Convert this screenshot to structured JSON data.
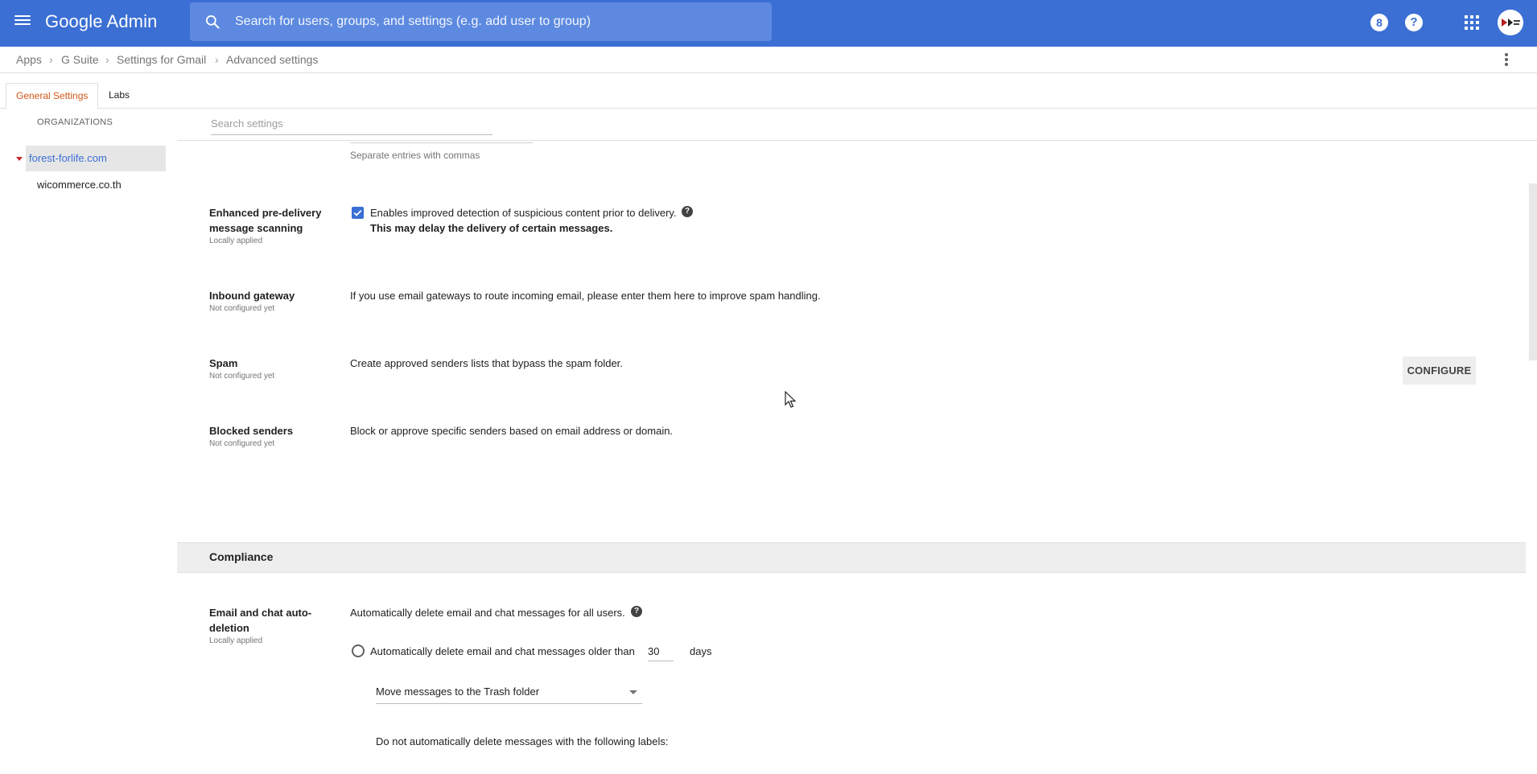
{
  "topbar": {
    "logo": "Google Admin",
    "search_placeholder": "Search for users, groups, and settings (e.g. add user to group)",
    "badge_icon": "8",
    "help_icon": "?",
    "accent": "#3b6fd4"
  },
  "breadcrumb": [
    "Apps",
    "G Suite",
    "Settings for Gmail",
    "Advanced settings"
  ],
  "tabs": [
    {
      "label": "General Settings",
      "active": true
    },
    {
      "label": "Labs",
      "active": false
    }
  ],
  "sidebar": {
    "heading": "ORGANIZATIONS",
    "orgs": [
      "forest-forlife.com",
      "wicommerce.co.th"
    ]
  },
  "settings_search": {
    "placeholder": "Search settings"
  },
  "prev_hint": "Separate entries with commas",
  "rows": [
    {
      "label": "Enhanced pre-delivery message scanning",
      "status": "Locally applied",
      "desc": "Enables improved detection of suspicious content prior to delivery.",
      "desc_bold": "This may delay the delivery of certain messages.",
      "checked": true
    },
    {
      "label": "Inbound gateway",
      "status": "Not configured yet",
      "desc": "If you use email gateways to route incoming email, please enter them here to improve spam handling."
    },
    {
      "label": "Spam",
      "status": "Not configured yet",
      "desc": "Create approved senders lists that bypass the spam folder.",
      "button": "CONFIGURE"
    },
    {
      "label": "Blocked senders",
      "status": "Not configured yet",
      "desc": "Block or approve specific senders based on email address or domain."
    }
  ],
  "compliance": {
    "section_title": "Compliance",
    "label": "Email and chat auto-deletion",
    "status": "Locally applied",
    "desc": "Automatically delete email and chat messages for all users.",
    "radio_label": "Automatically delete email and chat messages older than",
    "days_value": "30",
    "days_unit": "days",
    "action_select": "Move messages to the Trash folder",
    "labels_note": "Do not automatically delete messages with the following labels:"
  }
}
